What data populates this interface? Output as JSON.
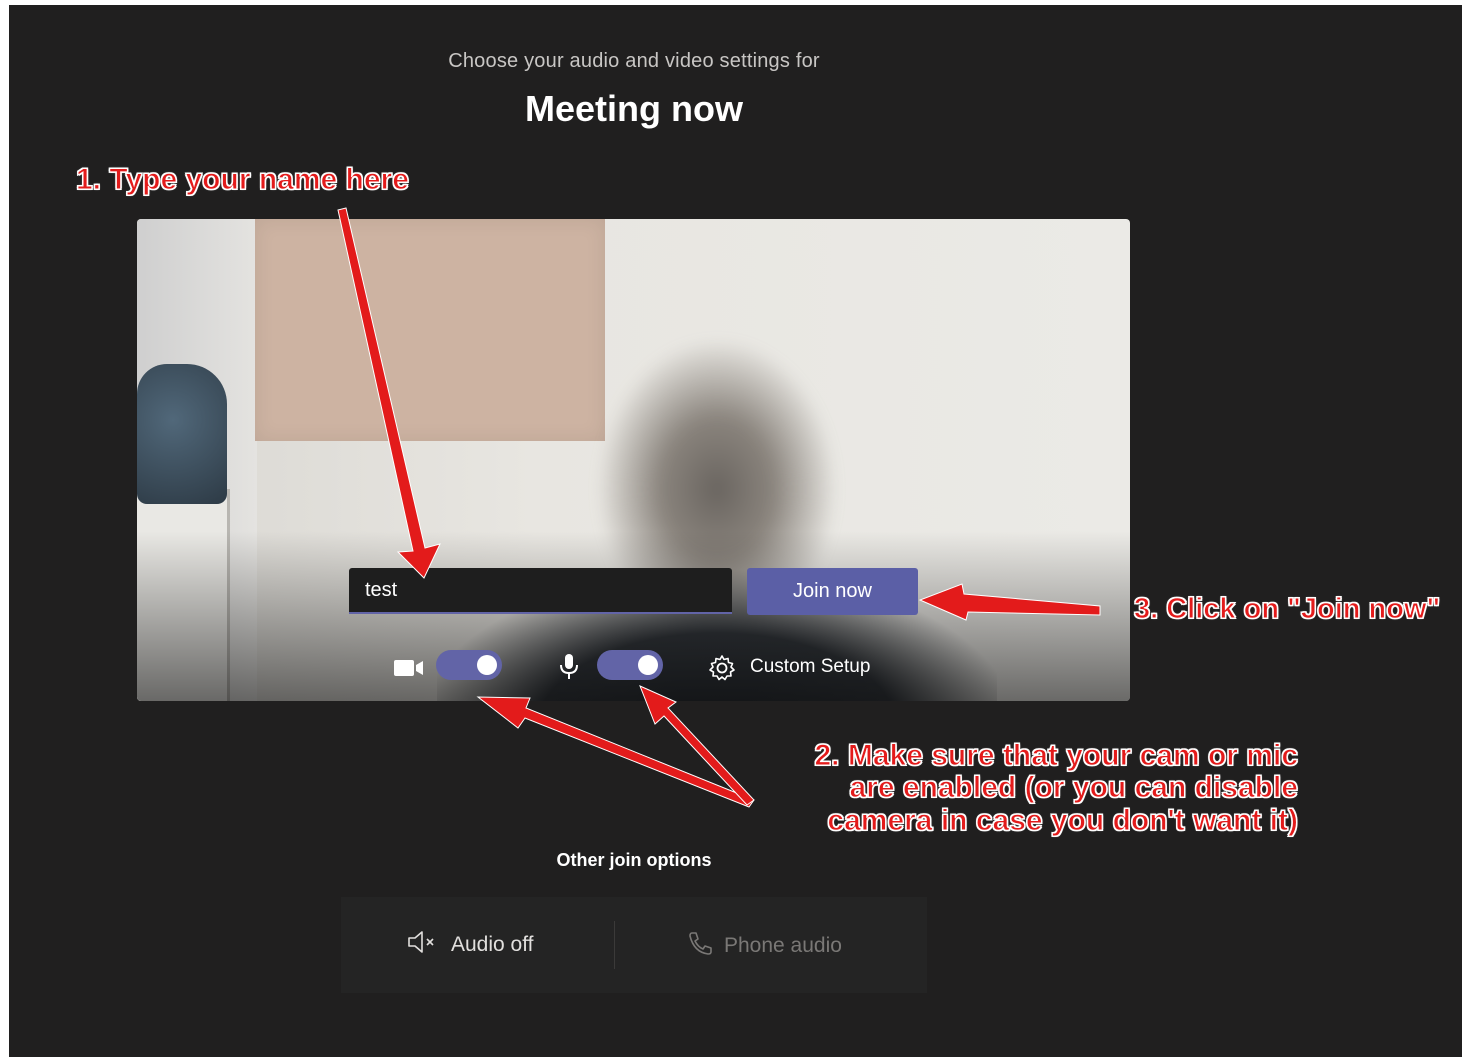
{
  "header": {
    "subtitle": "Choose your audio and video settings for",
    "title": "Meeting now"
  },
  "prejoin": {
    "name_value": "test",
    "join_label": "Join now",
    "camera_enabled": true,
    "mic_enabled": true,
    "custom_setup_label": "Custom Setup"
  },
  "other_options": {
    "heading": "Other join options",
    "audio_off_label": "Audio off",
    "phone_audio_label": "Phone audio"
  },
  "annotations": {
    "step1": "1. Type your name here",
    "step2_line1": "2. Make sure that your cam or mic",
    "step2_line2": "are enabled (or you can disable",
    "step2_line3": "camera in case you don't want it)",
    "step3": "3. Click on \"Join now\""
  },
  "colors": {
    "background": "#201f1f",
    "accent": "#6264a7",
    "annotation": "#e31b1b"
  },
  "icons": [
    "video-camera-icon",
    "microphone-icon",
    "gear-icon",
    "speaker-muted-icon",
    "phone-icon"
  ]
}
